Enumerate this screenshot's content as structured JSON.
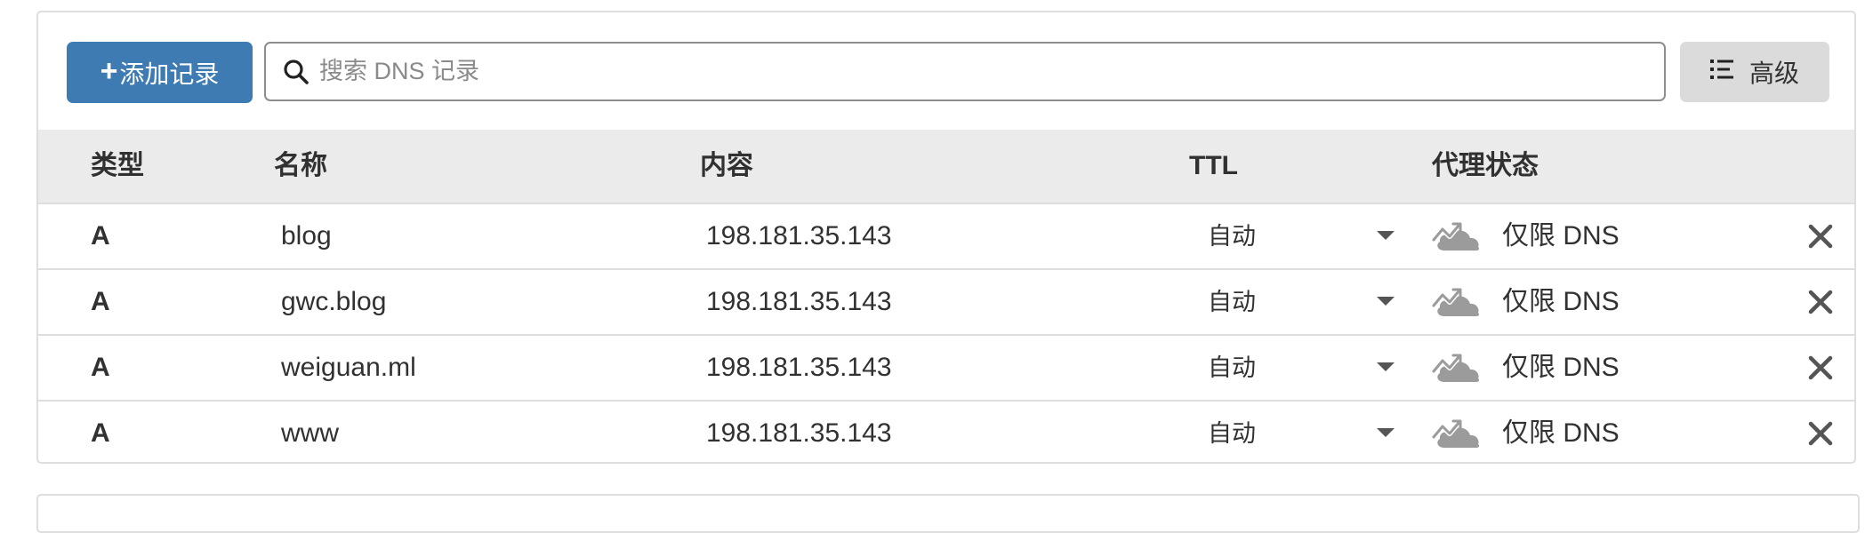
{
  "toolbar": {
    "add_button_plus": "+",
    "add_button_label": "添加记录",
    "search_placeholder": "搜索 DNS 记录",
    "search_value": "",
    "advanced_label": "高级"
  },
  "table": {
    "headers": {
      "type": "类型",
      "name": "名称",
      "content": "内容",
      "ttl": "TTL",
      "proxy": "代理状态"
    },
    "rows": [
      {
        "type": "A",
        "name": "blog",
        "content": "198.181.35.143",
        "ttl": "自动",
        "proxy": "仅限 DNS"
      },
      {
        "type": "A",
        "name": "gwc.blog",
        "content": "198.181.35.143",
        "ttl": "自动",
        "proxy": "仅限 DNS"
      },
      {
        "type": "A",
        "name": "weiguan.ml",
        "content": "198.181.35.143",
        "ttl": "自动",
        "proxy": "仅限 DNS"
      },
      {
        "type": "A",
        "name": "www",
        "content": "198.181.35.143",
        "ttl": "自动",
        "proxy": "仅限 DNS"
      }
    ]
  },
  "icons": {
    "search": "search-icon",
    "advanced": "list-icon",
    "ttl_dropdown": "caret-down-icon",
    "proxy": "dns-only-cloud-icon",
    "delete": "close-icon"
  },
  "colors": {
    "primary": "#3f7bb3",
    "header_bg": "#eaebea",
    "cloud_gray": "#9b9b9b"
  }
}
